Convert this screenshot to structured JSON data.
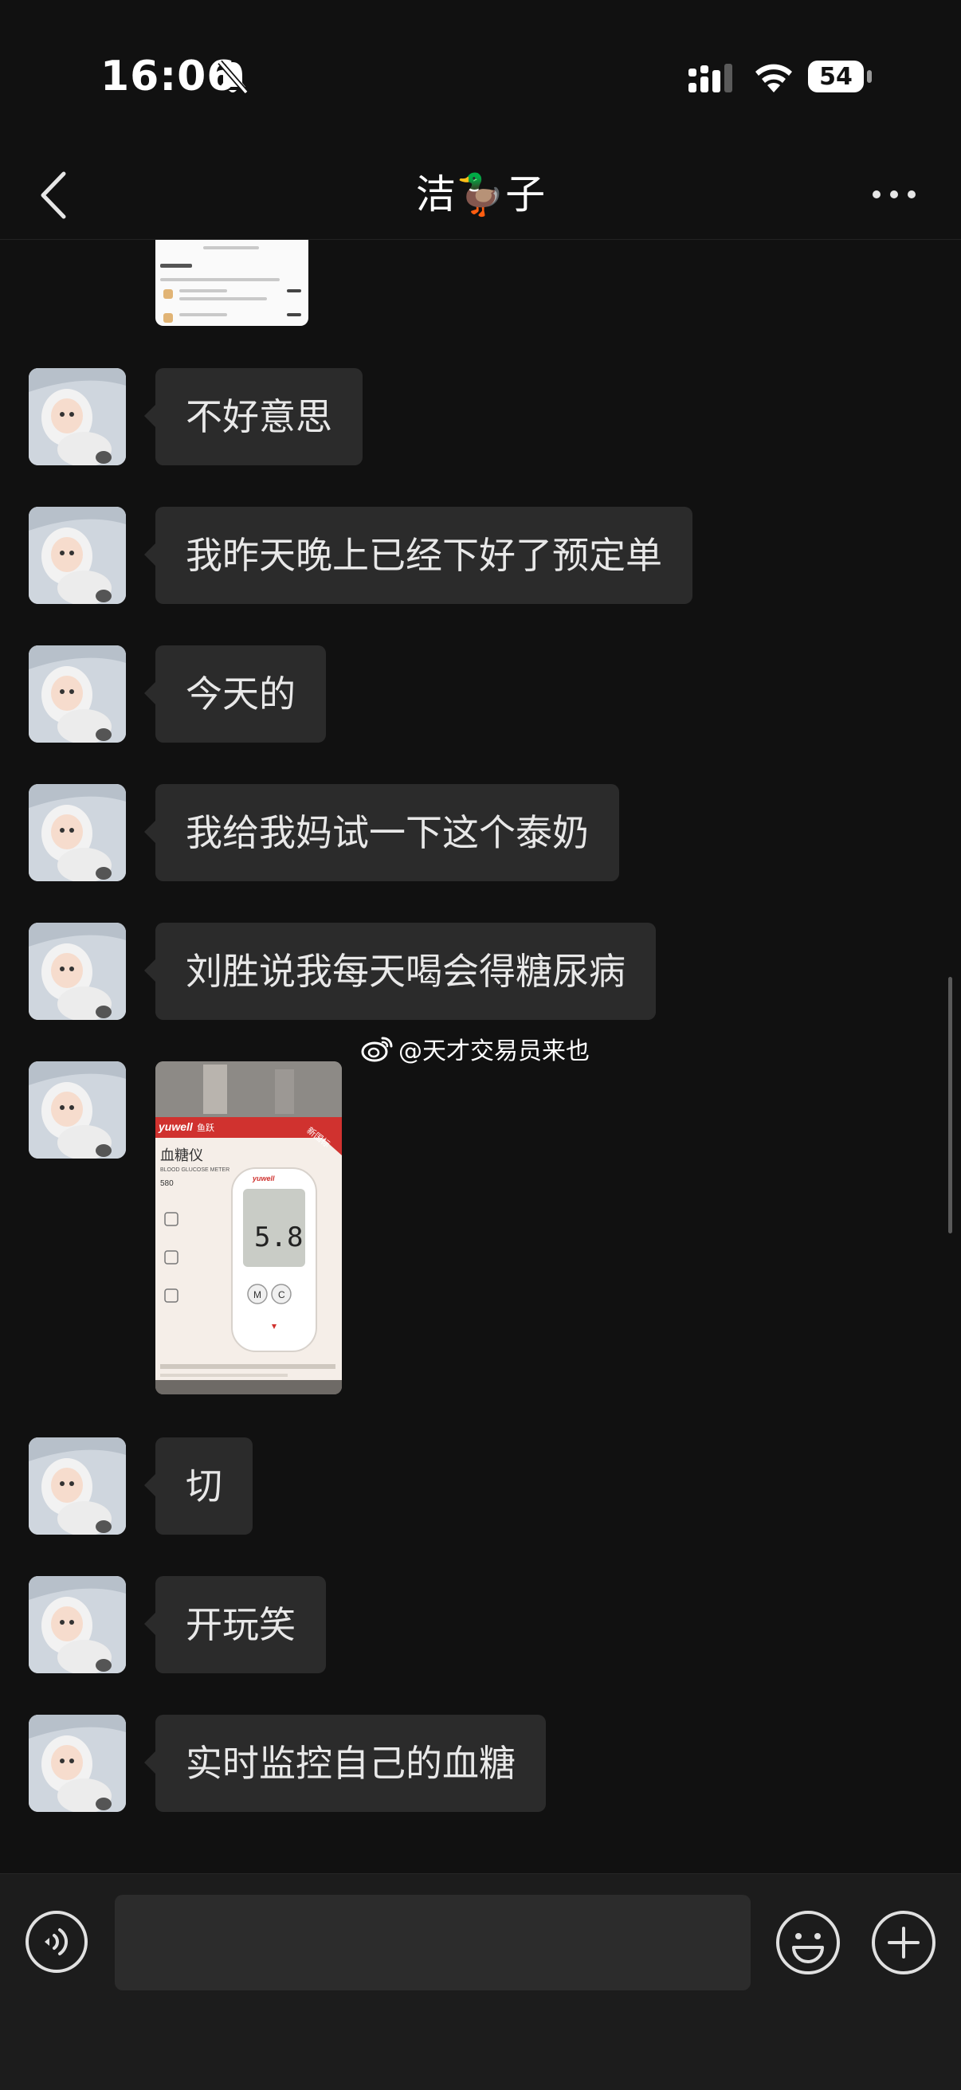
{
  "status_bar": {
    "time": "16:06",
    "battery": "54",
    "icons": [
      "bell-slash-icon",
      "cellular-signal-icon",
      "wifi-icon",
      "battery-icon"
    ]
  },
  "nav": {
    "title": "洁🦆子",
    "back_icon": "chevron-left-icon",
    "more_icon": "ellipsis-icon"
  },
  "messages": [
    {
      "type": "text",
      "text": "不好意思"
    },
    {
      "type": "text",
      "text": "我昨天晚上已经下好了预定单"
    },
    {
      "type": "text",
      "text": "今天的"
    },
    {
      "type": "text",
      "text": "我给我妈试一下这个泰奶"
    },
    {
      "type": "text",
      "text": "刘胜说我每天喝会得糖尿病"
    },
    {
      "type": "image",
      "content": "photo of a yuwell blood glucose meter box"
    },
    {
      "type": "text",
      "text": "切"
    },
    {
      "type": "text",
      "text": "开玩笑"
    },
    {
      "type": "text",
      "text": "实时监控自己的血糖"
    }
  ],
  "photo_texts": {
    "brand": "yuwell",
    "brand_cn": "鱼跃",
    "product": "血糖仪",
    "product_en": "BLOOD GLUCOSE METER",
    "model": "580",
    "badge": "新国标",
    "reading": "5.8",
    "btn_m": "M",
    "btn_c": "C"
  },
  "watermark": "@天才交易员来也",
  "input_bar": {
    "placeholder": "",
    "voice_icon": "voice-icon",
    "emoji_icon": "emoji-icon",
    "plus_icon": "plus-icon"
  },
  "colors": {
    "background": "#111111",
    "bubble": "#2b2b2b",
    "text": "#e8e8e8",
    "input_bar": "#1c1c1c"
  }
}
